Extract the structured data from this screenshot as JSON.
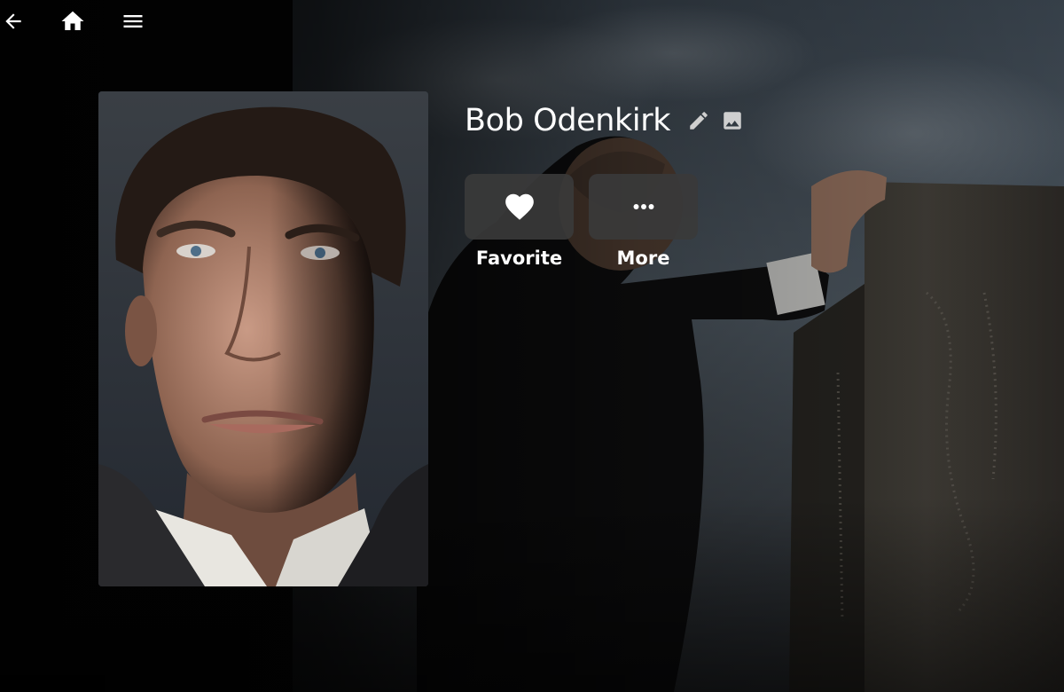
{
  "topbar": {
    "back_icon": "arrow-back",
    "home_icon": "home",
    "menu_icon": "hamburger-menu"
  },
  "person": {
    "name": "Bob Odenkirk",
    "edit_icon": "pencil",
    "image_icon": "image"
  },
  "actions": [
    {
      "label": "Favorite",
      "icon": "heart"
    },
    {
      "label": "More",
      "icon": "more-horizontal"
    }
  ],
  "colors": {
    "text": "#ffffff",
    "icon_muted": "#cfcfcf",
    "action_background": "#3a3a3a",
    "page_background": "#0b0b0b"
  }
}
